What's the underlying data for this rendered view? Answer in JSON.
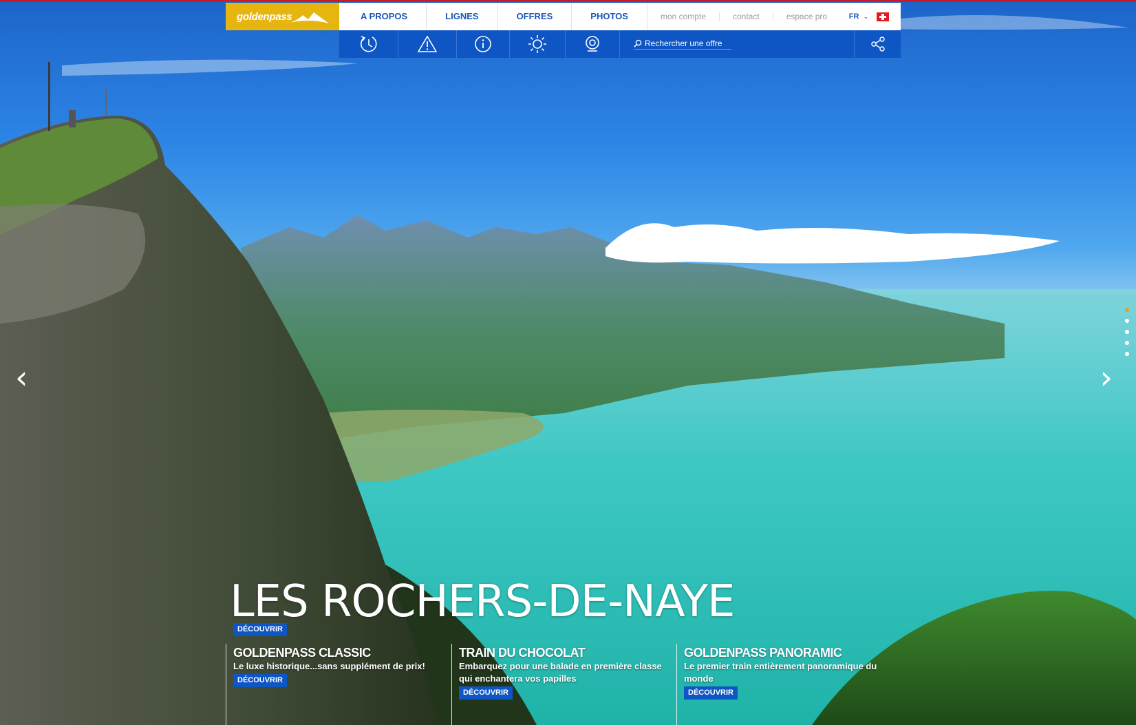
{
  "brand": {
    "logo_text": "goldenpass"
  },
  "nav": {
    "main": [
      "A PROPOS",
      "LIGNES",
      "OFFRES",
      "PHOTOS"
    ],
    "secondary": [
      "mon compte",
      "contact",
      "espace pro"
    ],
    "language": "FR"
  },
  "toolbar": {
    "icons": [
      "timetable-icon",
      "alert-icon",
      "info-icon",
      "weather-icon",
      "webcam-icon"
    ],
    "search_placeholder": "Rechercher une offre",
    "share_icon": "share-icon"
  },
  "hero": {
    "title": "LES ROCHERS-DE-NAYE",
    "button": "DÉCOUVRIR"
  },
  "slider": {
    "slide_count": 5,
    "active_index": 0
  },
  "cards": [
    {
      "title": "GOLDENPASS CLASSIC",
      "description": "Le luxe historique...sans supplément de prix!",
      "button": "DÉCOUVRIR"
    },
    {
      "title": "TRAIN DU CHOCOLAT",
      "description": "Embarquez pour une balade en première classe qui enchantera vos papilles",
      "button": "DÉCOUVRIR"
    },
    {
      "title": "GOLDENPASS PANORAMIC",
      "description": "Le premier train entièrement panoramique du monde",
      "button": "DÉCOUVRIR"
    }
  ],
  "colors": {
    "brand_gold": "#e6b510",
    "brand_blue": "#0f56c5",
    "top_line": "#c41e2a"
  }
}
